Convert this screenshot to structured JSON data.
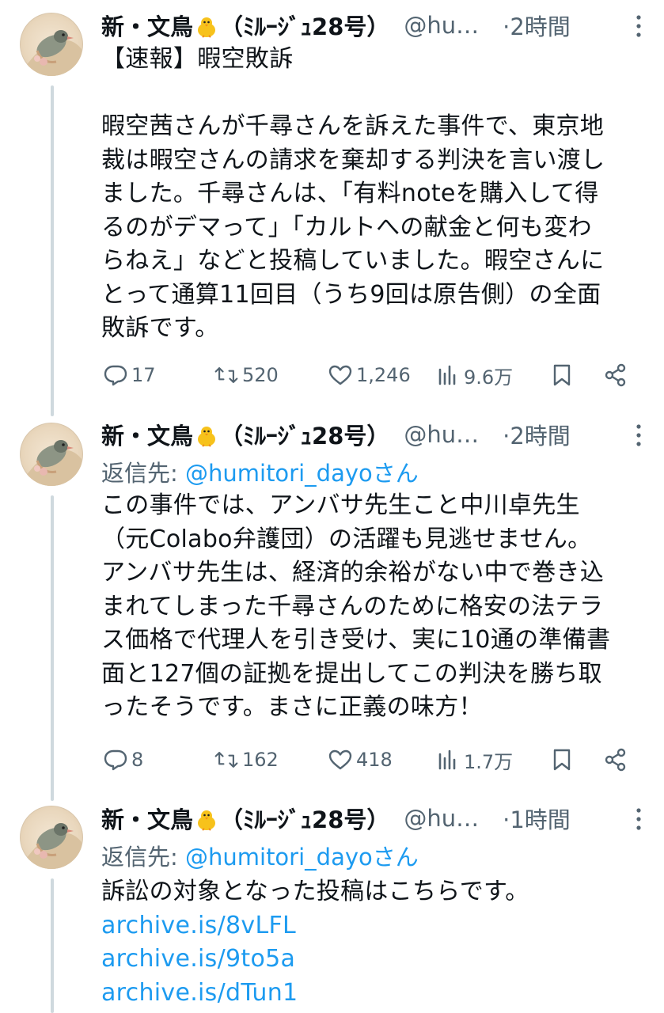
{
  "tweets": [
    {
      "author_name": "新・文鳥",
      "author_suffix": "（ﾐﾙｰｼﾞｭ28号）",
      "handle": "@hu…",
      "time": "·2時間",
      "reply_to_prefix": "",
      "reply_to_mention": "",
      "reply_to_suffix": "",
      "lines": [
        "【速報】暇空敗訴",
        "",
        "暇空茜さんが千尋さんを訴えた事件で、東京地",
        "裁は暇空さんの請求を棄却する判決を言い渡し",
        "ました。千尋さんは、「有料noteを購入して得",
        "るのがデマって」「カルトへの献金と何も変わ",
        "らねえ」などと投稿していました。暇空さんに",
        "とって通算11回目（うち9回は原告側）の全面",
        "敗訴です。"
      ],
      "links": [],
      "replies": "17",
      "retweets": "520",
      "likes": "1,246",
      "views": "9.6万"
    },
    {
      "author_name": "新・文鳥",
      "author_suffix": "（ﾐﾙｰｼﾞｭ28号）",
      "handle": "@hu…",
      "time": "·2時間",
      "reply_to_prefix": "返信先: ",
      "reply_to_mention": "@humitori_dayo",
      "reply_to_suffix": "さん",
      "lines": [
        "この事件では、アンバサ先生こと中川卓先生",
        "（元Colabo弁護団）の活躍も見逃せません。",
        "アンバサ先生は、経済的余裕がない中で巻き込",
        "まれてしまった千尋さんのために格安の法テラ",
        "ス価格で代理人を引き受け、実に10通の準備書",
        "面と127個の証拠を提出してこの判決を勝ち取",
        "ったそうです。まさに正義の味方！"
      ],
      "links": [],
      "replies": "8",
      "retweets": "162",
      "likes": "418",
      "views": "1.7万"
    },
    {
      "author_name": "新・文鳥",
      "author_suffix": "（ﾐﾙｰｼﾞｭ28号）",
      "handle": "@hu…",
      "time": "·1時間",
      "reply_to_prefix": "返信先: ",
      "reply_to_mention": "@humitori_dayo",
      "reply_to_suffix": "さん",
      "lines": [
        "訴訟の対象となった投稿はこちらです。"
      ],
      "links": [
        "archive.is/8vLFL",
        "archive.is/9to5a",
        "archive.is/dTun1"
      ]
    }
  ],
  "colors": {
    "text": "#0f1419",
    "secondary": "#536471",
    "link": "#1d9bf0",
    "thread_line": "#cfd9de"
  },
  "icons": {
    "reply": "speech-bubble-icon",
    "retweet": "retweet-arrows-icon",
    "like": "heart-icon",
    "views": "bar-chart-icon",
    "bookmark": "bookmark-icon",
    "share": "share-nodes-icon",
    "more": "vertical-dots-icon",
    "emoji": "baby-chick-emoji"
  }
}
